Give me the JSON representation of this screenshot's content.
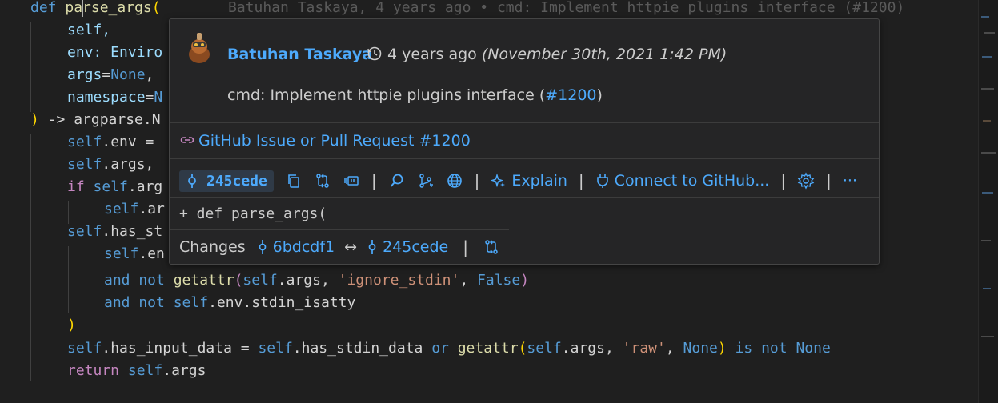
{
  "code": {
    "line1": {
      "def": "def",
      "name_a": "pa",
      "name_b": "rse_args",
      "paren": "(",
      "blame": "Batuhan Taskaya, 4 years ago • cmd: Implement httpie plugins interface (#1200)"
    },
    "line2": {
      "text": "self,"
    },
    "line3": {
      "text": "env: Enviro"
    },
    "line4": {
      "name": "args",
      "eq": "=",
      "val": "None",
      "comma": ","
    },
    "line5": {
      "name": "namespace",
      "eq": "=",
      "val": "N"
    },
    "line6": {
      "paren": ")",
      "rest": " -> argparse.N"
    },
    "line7": {
      "self": "self",
      "rest": ".env = "
    },
    "line8": {
      "self": "self",
      "rest": ".args,"
    },
    "line9": {
      "kw": "if",
      "self": "self",
      "rest": ".arg"
    },
    "line10": {
      "self": "self",
      "rest": ".ar"
    },
    "line11": {
      "self": "self",
      "rest": ".has_st"
    },
    "line12": {
      "self": "self",
      "rest": ".en"
    },
    "line13": {
      "kw": "and not",
      "fn": "getattr",
      "p1": "(",
      "self": "self",
      "mid": ".args, ",
      "str": "'ignore_stdin'",
      "c": ", ",
      "val": "False",
      "p2": ")"
    },
    "line14": {
      "kw": "and not",
      "self": "self",
      "rest": ".env.stdin_isatty"
    },
    "line15": {
      "paren": ")"
    },
    "line16": {
      "self1": "self",
      "a": ".has_input_data = ",
      "self2": "self",
      "b": ".has_stdin_data ",
      "kw1": "or",
      "fn": "getattr",
      "p1": "(",
      "self3": "self",
      "c": ".args, ",
      "str": "'raw'",
      "d": ", ",
      "val": "None",
      "p2": ")",
      "kw2": "is not",
      "val2": "None"
    },
    "line17": {
      "kw": "return",
      "self": "self",
      "rest": ".args"
    }
  },
  "hover": {
    "author": "Batuhan Taskaya",
    "ago": "4 years ago",
    "date": "(November 30th, 2021 1:42 PM)",
    "message_prefix": "cmd: Implement httpie plugins interface (",
    "message_link": "#1200",
    "message_suffix": ")",
    "github_link": "GitHub Issue or Pull Request #1200",
    "sha": "245cede",
    "explain": "Explain",
    "connect": "Connect to GitHub...",
    "more": "···",
    "separator": "|",
    "diff_line": "+ def parse_args(",
    "changes_label": "Changes",
    "from_sha": "6bdcdf1",
    "arrow": "↔",
    "to_sha": "245cede"
  },
  "colors": {
    "accent": "#4daafc",
    "keyword": "#569cd6",
    "control": "#c586c0",
    "function": "#dcdcaa",
    "variable": "#9cdcfe",
    "string": "#ce9178"
  }
}
